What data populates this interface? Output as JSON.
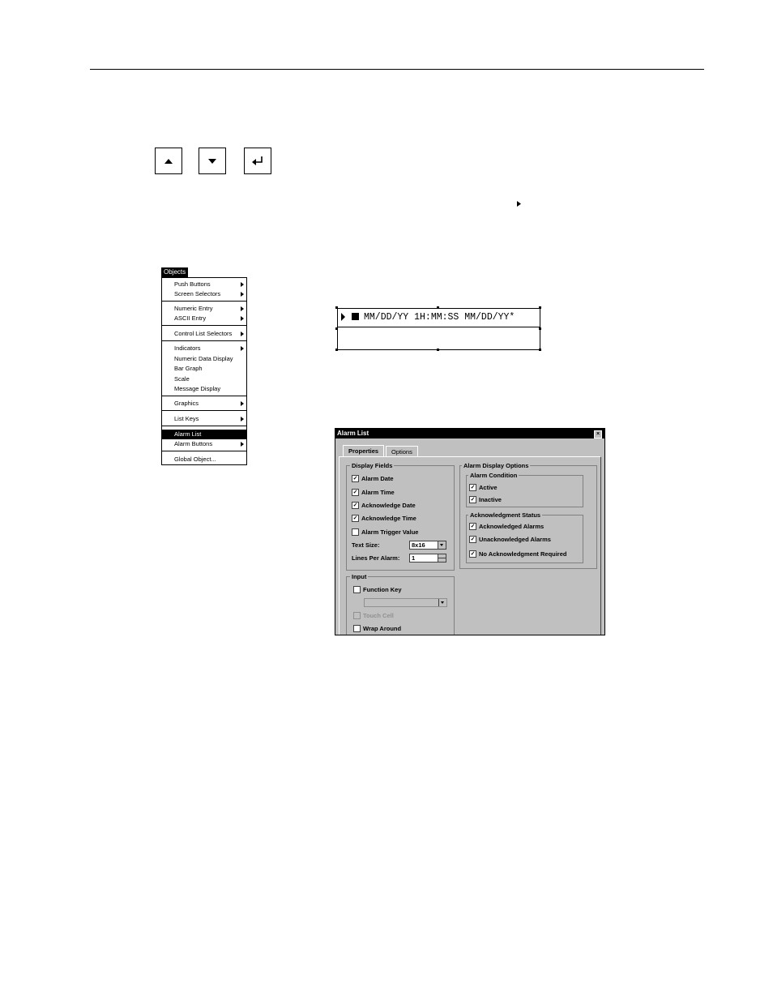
{
  "keys": {
    "up": "up-arrow-key",
    "down": "down-arrow-key",
    "enter": "enter-key"
  },
  "objects_menu": {
    "title": "Objects",
    "items": [
      {
        "label": "Push Buttons",
        "submenu": true
      },
      {
        "label": "Screen Selectors",
        "submenu": true
      },
      {
        "label": "Numeric Entry",
        "submenu": true
      },
      {
        "label": "ASCII Entry",
        "submenu": true
      },
      {
        "label": "Control List Selectors",
        "submenu": true
      },
      {
        "label": "Indicators",
        "submenu": true
      },
      {
        "label": "Numeric Data Display",
        "submenu": false
      },
      {
        "label": "Bar Graph",
        "submenu": false
      },
      {
        "label": "Scale",
        "submenu": false
      },
      {
        "label": "Message Display",
        "submenu": false
      },
      {
        "label": "Graphics",
        "submenu": true
      },
      {
        "label": "List Keys",
        "submenu": true
      },
      {
        "label": "Alarm List",
        "submenu": false,
        "selected": true
      },
      {
        "label": "Alarm Buttons",
        "submenu": true
      },
      {
        "label": "Global Object...",
        "submenu": false
      }
    ]
  },
  "preview": {
    "text": "MM/DD/YY 1H:MM:SS MM/DD/YY*"
  },
  "dialog": {
    "title": "Alarm List",
    "tabs": [
      "Properties",
      "Options"
    ],
    "display_fields": {
      "label": "Display Fields",
      "alarm_date": "Alarm Date",
      "alarm_time": "Alarm Time",
      "ack_date": "Acknowledge Date",
      "ack_time": "Acknowledge Time",
      "trigger_value": "Alarm Trigger Value",
      "text_size_label": "Text Size:",
      "text_size_value": "8x16",
      "lines_label": "Lines Per Alarm:",
      "lines_value": "1"
    },
    "input": {
      "label": "Input",
      "function_key": "Function Key",
      "function_key_value": "",
      "touch_cell": "Touch Cell",
      "wrap_around": "Wrap Around"
    },
    "alarm_display_options": {
      "label": "Alarm Display Options",
      "condition_label": "Alarm Condition",
      "active": "Active",
      "inactive": "Inactive",
      "ack_status_label": "Acknowledgment Status",
      "acknowledged": "Acknowledged Alarms",
      "unacknowledged": "Unacknowledged Alarms",
      "no_ack": "No Acknowledgment Required"
    },
    "check_mark": "✓"
  }
}
